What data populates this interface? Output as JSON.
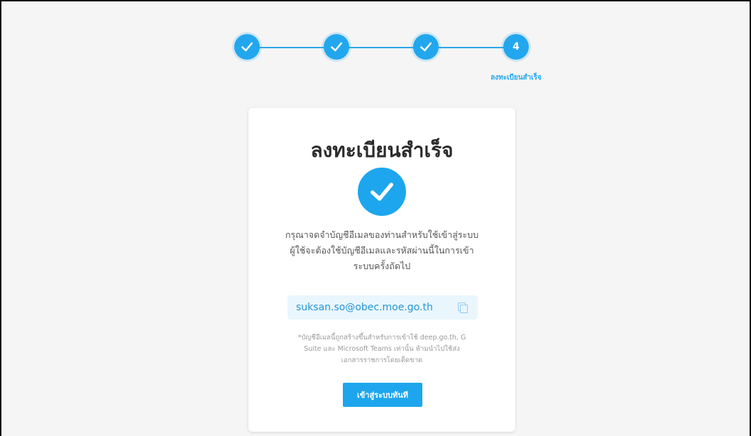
{
  "stepper": {
    "steps": [
      {
        "state": "completed",
        "icon": "check-icon"
      },
      {
        "state": "completed",
        "icon": "check-icon"
      },
      {
        "state": "completed",
        "icon": "check-icon"
      },
      {
        "state": "current",
        "number": "4"
      }
    ],
    "current_label": "ลงทะเบียนสำเร็จ"
  },
  "card": {
    "title": "ลงทะเบียนสำเร็จ",
    "success_icon": "check-circle-icon",
    "message_lines": [
      "กรุณาจดจำบัญชีอีเมลของท่านสำหรับใช้เข้าสู่ระบบ",
      "ผู้ใช้จะต้องใช้บัญชีอีเมลและรหัสผ่านนี้ในการเข้า",
      "ระบบครั้งถัดไป"
    ],
    "email": "suksan.so@obec.moe.go.th",
    "copy_icon": "copy-icon",
    "note_lines": [
      "*บัญชีอีเมลนี้ถูกสร้างขึ้นสำหรับการเข้าใช้ deep.go.th, G",
      "Suite และ Microsoft Teams เท่านั้น ห้ามนำไปใช้ส่ง",
      "เอกสารราชการโดยเด็ดขาด"
    ],
    "button_label": "เข้าสู่ระบบทันที"
  },
  "colors": {
    "accent": "#22a7ee",
    "background": "#f5f5f5",
    "card": "#ffffff",
    "email_bg": "#eaf6fd"
  }
}
